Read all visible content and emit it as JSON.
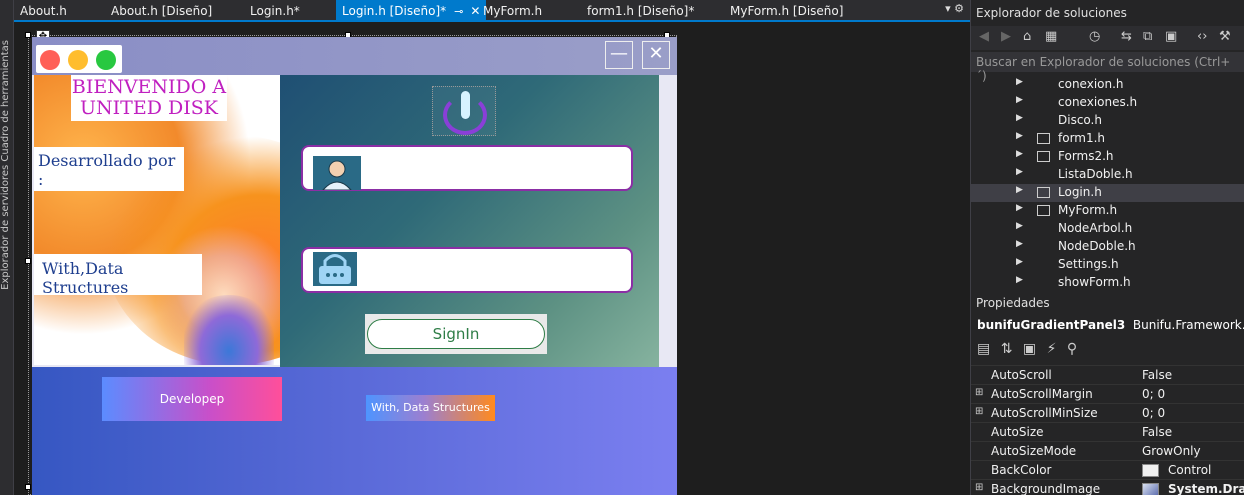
{
  "tabs": [
    {
      "label": "About.h"
    },
    {
      "label": "About.h [Diseño]"
    },
    {
      "label": "Login.h*"
    },
    {
      "label": "Login.h [Diseño]*"
    },
    {
      "label": "MyForm.h"
    },
    {
      "label": "form1.h [Diseño]*"
    },
    {
      "label": "MyForm.h [Diseño]"
    }
  ],
  "left_strip_text": "Explorador de servidores   Cuadro de herramientas",
  "form": {
    "welcome_label": "BIENVENIDO A UNITED DISK",
    "developed_label": "Desarrollado  por :",
    "ds_label": "With,Data Structures",
    "user_value": "",
    "pass_value": "",
    "signin_label": "SignIn",
    "develop_button_label": "Developep",
    "ds_button_label": "With, Data Structures"
  },
  "solution_explorer": {
    "title": "Explorador de soluciones",
    "search_placeholder": "Buscar en Explorador de soluciones (Ctrl+´)",
    "items": [
      {
        "label": "conexion.h"
      },
      {
        "label": "conexiones.h"
      },
      {
        "label": "Disco.h"
      },
      {
        "label": "form1.h"
      },
      {
        "label": "Forms2.h"
      },
      {
        "label": "ListaDoble.h"
      },
      {
        "label": "Login.h",
        "selected": true
      },
      {
        "label": "MyForm.h"
      },
      {
        "label": "NodeArbol.h"
      },
      {
        "label": "NodeDoble.h"
      },
      {
        "label": "Settings.h"
      },
      {
        "label": "showForm.h"
      }
    ]
  },
  "properties": {
    "title": "Propiedades",
    "object_name": "bunifuGradientPanel3",
    "object_type": "Bunifu.Framework.UI.Bunifu",
    "rows": [
      {
        "name": "AutoScroll",
        "value": "False"
      },
      {
        "name": "AutoScrollMargin",
        "value": "0; 0"
      },
      {
        "name": "AutoScrollMinSize",
        "value": "0; 0"
      },
      {
        "name": "AutoSize",
        "value": "False"
      },
      {
        "name": "AutoSizeMode",
        "value": "GrowOnly"
      },
      {
        "name": "BackColor",
        "value": "Control"
      },
      {
        "name": "BackgroundImage",
        "value": "System.Drawi"
      }
    ]
  },
  "colors": {
    "vs_accent": "#007acc",
    "welcome_text": "#c020c0",
    "label_text": "#1f3f8f",
    "field_border": "#8b2ea5",
    "signin_text": "#2e7d46"
  }
}
